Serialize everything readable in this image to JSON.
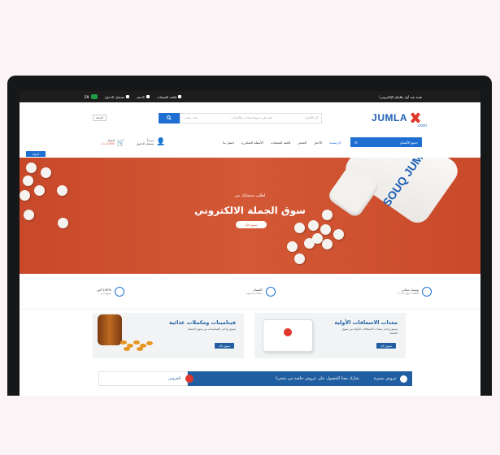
{
  "topbar": {
    "promo": "هدية عند أول طلبكم الإلكتروني!",
    "wishlist": "قائمة المنتجات",
    "help": "الدعم",
    "login": "تسجيل الدخول",
    "lang": "EN"
  },
  "header": {
    "logo_text": "JUMLA",
    "logo_suffix": ".com",
    "search_placeholder": "ابحث في جميع المنتجات والأقسام...",
    "search_category": "كل الأقسام",
    "search_secondary": "بحث متقدم",
    "mini_button": "العملة"
  },
  "nav": {
    "categories_label": "جميع الأقسام",
    "links": [
      "الرئيسية",
      "الأخبار",
      "المتجر",
      "قائمة المنتجات",
      "الأسئلة المتكررة",
      "اتصل بنا"
    ],
    "account_top": "مرحباً",
    "account_bottom": "تسجيل الدخول",
    "cart_top": "السلة",
    "cart_bottom": "0.000 د.ك",
    "cart_count": "0"
  },
  "ribbon": "الدولة",
  "hero": {
    "small": "اطلب منتجاتك من",
    "big": "سوق الجملة الالكتروني",
    "cta": "تسوق الآن",
    "bottle_label": "SOUQ JUMLA"
  },
  "features": [
    {
      "title": "توصيل مجاني",
      "sub": "للطلبات فوق 50 د.ك"
    },
    {
      "title": "الضمان",
      "sub": "منتجات مضمونة"
    },
    {
      "title": "100% آمن",
      "sub": "تسوق آمن"
    }
  ],
  "cards": {
    "first_aid": {
      "title": "معدات الاسعافات الأولية",
      "sub": "تسوق واختر معدات الاسعافات الأولية من سوق الجملة",
      "button": "تسوق الآن"
    },
    "vitamins": {
      "title": "فيتامينات ومكملات غذائية",
      "sub": "تسوق واختر الفيتامينات من سوق الجملة",
      "button": "تسوق الآن"
    }
  },
  "offers": {
    "tag": "عروض مميزة",
    "text": "شارك معنا للحصول على عروض خاصة من متجرنا",
    "white_label": "العروض"
  }
}
